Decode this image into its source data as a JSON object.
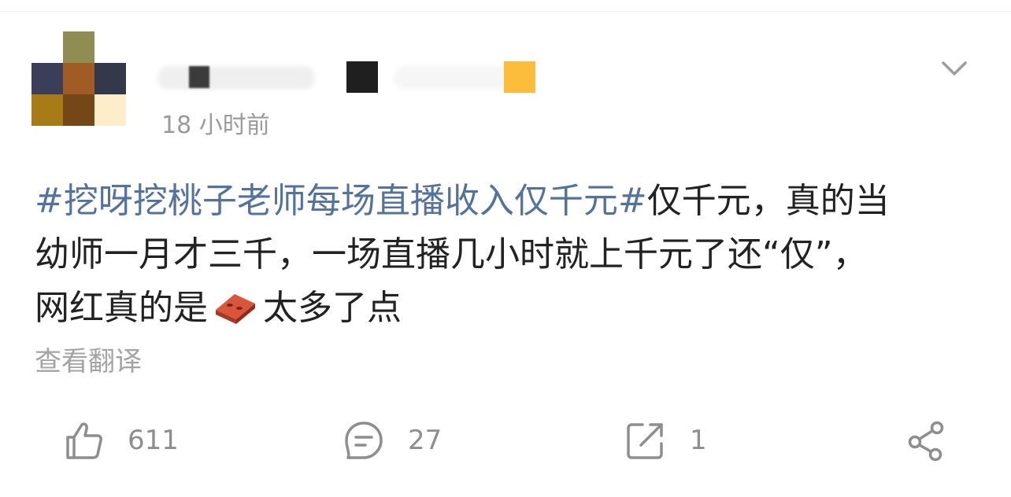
{
  "post": {
    "timestamp": "18 小时前",
    "content_lines": [
      {
        "hashtag": "#挖呀挖桃子老师每场直播收入仅千元#",
        "text": "仅千元，真的当"
      },
      {
        "text": "幼师一月才三千，一场直播几小时就上千元了还“仅”，"
      },
      {
        "text_before_emoji": "网红真的是",
        "emoji": "brick-emoji",
        "text_after_emoji": "太多了点"
      }
    ],
    "translate_label": "查看翻译"
  },
  "actions": {
    "like": {
      "icon": "thumbs-up-icon",
      "count": "611"
    },
    "comment": {
      "icon": "comment-icon",
      "count": "27"
    },
    "repost": {
      "icon": "repost-icon",
      "count": "1"
    },
    "share": {
      "icon": "share-icon"
    }
  },
  "menu": {
    "icon": "chevron-down-icon"
  },
  "colors": {
    "hashtag": "#53729e",
    "text": "#222222",
    "meta": "#9a9a9a",
    "icon": "#8e8e8e"
  }
}
